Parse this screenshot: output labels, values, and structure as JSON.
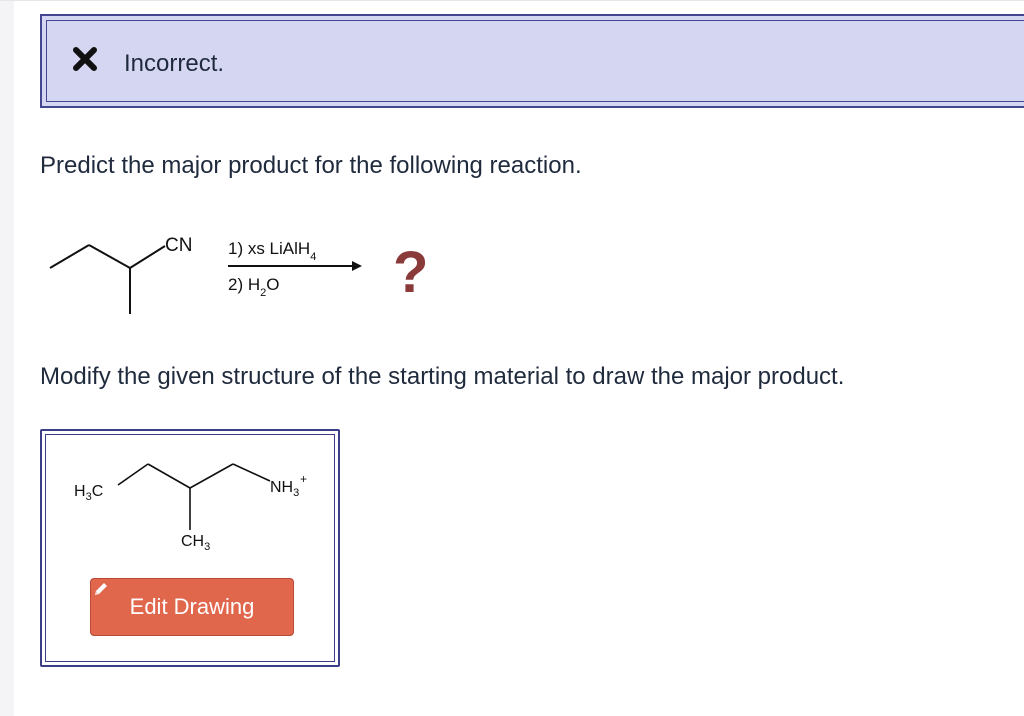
{
  "feedback": {
    "status_icon": "x-icon",
    "text": "Incorrect."
  },
  "question": {
    "prompt": "Predict the major product for the following reaction.",
    "instruction": "Modify the given structure of the starting material to draw the major product."
  },
  "reaction": {
    "substituent": "CN",
    "step1_prefix": "1) xs LiAlH",
    "step1_sub": "4",
    "step2_prefix": "2) H",
    "step2_sub": "2",
    "step2_suffix": "O",
    "product_placeholder": "?"
  },
  "answer": {
    "left_group": "H",
    "left_group_sub": "3",
    "left_group_suffix": "C",
    "branch_group": "CH",
    "branch_group_sub": "3",
    "right_group": "NH",
    "right_group_sub": "3",
    "right_group_charge": "+",
    "edit_button_label": "Edit Drawing",
    "edit_icon": "pencil-icon"
  },
  "colors": {
    "feedback_bg": "#d5d6f2",
    "border": "#44478f",
    "question_mark": "#8b3a3a",
    "button_bg": "#e0664c"
  }
}
